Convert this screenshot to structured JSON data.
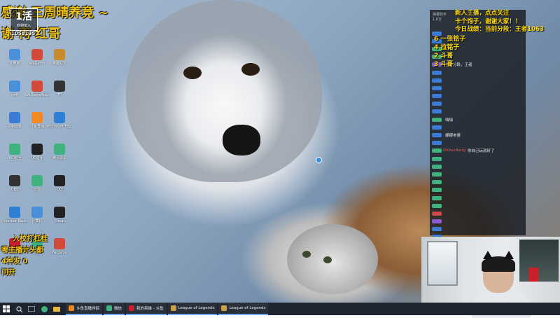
{
  "overlay": {
    "top_line1": "感谢   三周晴养竞 ~",
    "top_line2": "谢   再   红哥",
    "corner_logo": "1活",
    "corner_small": "欢迎加入",
    "corner_num": "1058195",
    "bottom_line1": "入校打杠桂",
    "bottom_line2": "   哪主播计头都",
    "bottom_line3": "   4种发      0",
    "bottom_line4": "   问开"
  },
  "chat": {
    "header_left": "弹幕助手",
    "header_count": "1.6万",
    "notice": [
      "新人主播，点点关注",
      "卡个饱子，谢谢大家！！",
      "今日战绩：当前分段：王者1063"
    ],
    "commands": [
      "6 一张铭子",
      "4 拉铭子",
      "2 斗哥",
      "3 斗哥"
    ],
    "messages": [
      {
        "name": "",
        "msg": "",
        "badge": "#3a7bd5"
      },
      {
        "name": "",
        "msg": "",
        "badge": "#3a7bd5"
      },
      {
        "name": "",
        "msg": "",
        "badge": "#3fb27f"
      },
      {
        "name": "",
        "msg": "",
        "badge": "#3fb27f"
      },
      {
        "name": "",
        "msg": "当前分段，王者",
        "badge": "#8e5bd6"
      },
      {
        "name": "",
        "msg": "",
        "badge": "#3a7bd5"
      },
      {
        "name": "",
        "msg": "",
        "badge": "#3a7bd5"
      },
      {
        "name": "",
        "msg": "",
        "badge": "#3a7bd5"
      },
      {
        "name": "",
        "msg": "",
        "badge": "#3a7bd5"
      },
      {
        "name": "",
        "msg": "",
        "badge": "#3a7bd5"
      },
      {
        "name": "",
        "msg": "",
        "badge": "#3a7bd5"
      },
      {
        "name": "",
        "msg": "嗨嗨",
        "badge": "#3fb27f"
      },
      {
        "name": "",
        "msg": "",
        "badge": "#3a7bd5"
      },
      {
        "name": "",
        "msg": "娜娜老婆",
        "badge": "#3a7bd5"
      },
      {
        "name": "",
        "msg": "",
        "badge": "#3a7bd5"
      },
      {
        "name": "OKAsoBang",
        "msg": "你自己玩就好了",
        "badge": "#3fb27f"
      },
      {
        "name": "",
        "msg": "",
        "badge": "#3fb27f"
      },
      {
        "name": "",
        "msg": "",
        "badge": "#3fb27f"
      },
      {
        "name": "",
        "msg": "",
        "badge": "#3fb27f"
      },
      {
        "name": "",
        "msg": "",
        "badge": "#3fb27f"
      },
      {
        "name": "",
        "msg": "",
        "badge": "#3fb27f"
      },
      {
        "name": "",
        "msg": "",
        "badge": "#3fb27f"
      },
      {
        "name": "",
        "msg": "",
        "badge": "#3fb27f"
      },
      {
        "name": "",
        "msg": "",
        "badge": "#c94a4a"
      },
      {
        "name": "",
        "msg": "",
        "badge": "#8e5bd6"
      },
      {
        "name": "",
        "msg": "",
        "badge": "#3a7bd5"
      },
      {
        "name": "",
        "msg": "",
        "badge": "#3a7bd5"
      }
    ]
  },
  "desktop_icons": [
    {
      "label": "此电脑",
      "color": "#4a90d9"
    },
    {
      "label": "WeGame",
      "color": "#d44a3a"
    },
    {
      "label": "英雄联盟",
      "color": "#c98a2a"
    },
    {
      "label": "网络",
      "color": "#4a90d9"
    },
    {
      "label": "WeGameApps",
      "color": "#d44a3a"
    },
    {
      "label": "TP",
      "color": "#333333"
    },
    {
      "label": "控制面板",
      "color": "#3a7bd5"
    },
    {
      "label": "斗鱼直播",
      "color": "#f08a24"
    },
    {
      "label": "Microsoft Edge",
      "color": "#2f7fd5"
    },
    {
      "label": "360安全",
      "color": "#3fb27f"
    },
    {
      "label": "QQ音乐",
      "color": "#222222"
    },
    {
      "label": "腾讯会议",
      "color": "#3fb27f"
    },
    {
      "label": "OBS",
      "color": "#333333"
    },
    {
      "label": "迅雷",
      "color": "#3fb27f"
    },
    {
      "label": "QQ",
      "color": "#222222"
    },
    {
      "label": "Internet Explorer",
      "color": "#2f7fd5"
    },
    {
      "label": "计算机",
      "color": "#4a90d9"
    },
    {
      "label": "Cheat",
      "color": "#222222"
    },
    {
      "label": "网易云音乐",
      "color": "#c8202a"
    },
    {
      "label": "微信",
      "color": "#3fb27f"
    },
    {
      "label": "Wegame",
      "color": "#d44a3a"
    }
  ],
  "taskbar": {
    "apps": [
      {
        "label": "斗鱼直播伴侣",
        "color": "#f08a24"
      },
      {
        "label": "微信",
        "color": "#3fb27f"
      },
      {
        "label": "我的英雄 - 斗鱼",
        "color": "#c8202a"
      },
      {
        "label": "League of Legends",
        "color": "#c9a14a"
      },
      {
        "label": "League of Legends",
        "color": "#c9a14a"
      }
    ]
  }
}
